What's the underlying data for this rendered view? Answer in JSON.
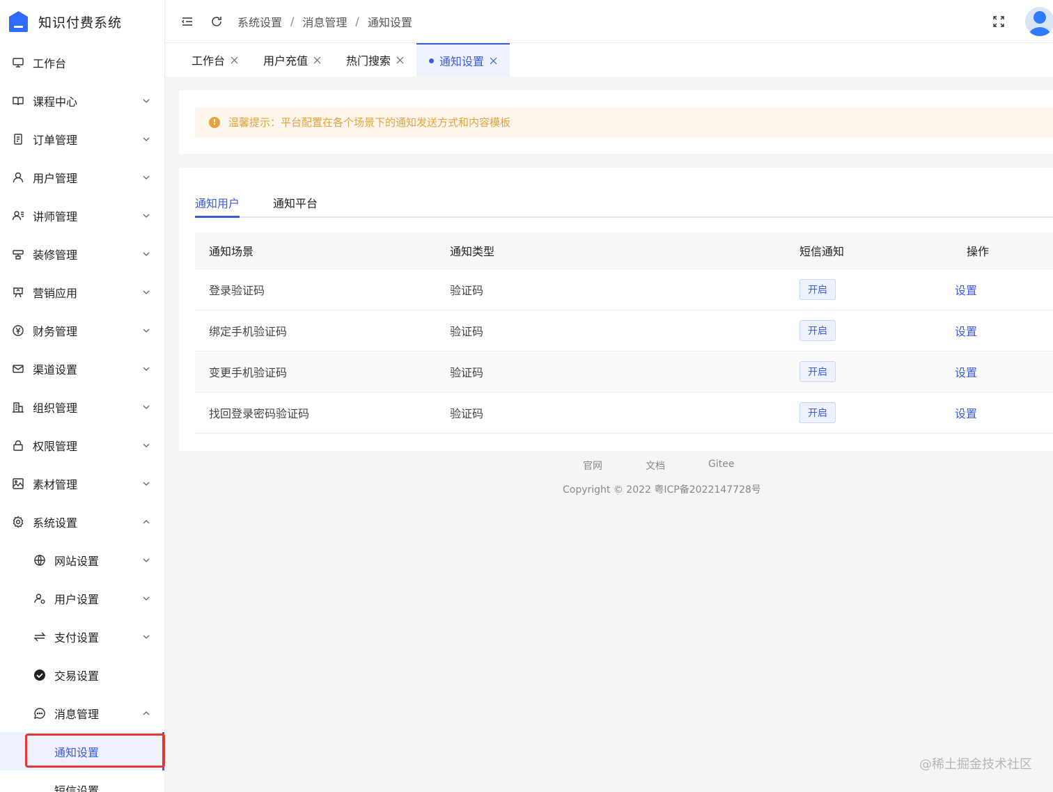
{
  "app": {
    "title": "知识付费系统"
  },
  "sidebar": {
    "items": [
      {
        "label": "工作台",
        "icon": "monitor-icon"
      },
      {
        "label": "课程中心",
        "icon": "book-icon"
      },
      {
        "label": "订单管理",
        "icon": "order-icon"
      },
      {
        "label": "用户管理",
        "icon": "user-icon"
      },
      {
        "label": "讲师管理",
        "icon": "teacher-icon"
      },
      {
        "label": "装修管理",
        "icon": "decoration-icon"
      },
      {
        "label": "营销应用",
        "icon": "marketing-icon"
      },
      {
        "label": "财务管理",
        "icon": "yuan-icon"
      },
      {
        "label": "渠道设置",
        "icon": "mail-icon"
      },
      {
        "label": "组织管理",
        "icon": "building-icon"
      },
      {
        "label": "权限管理",
        "icon": "lock-icon"
      },
      {
        "label": "素材管理",
        "icon": "image-icon"
      },
      {
        "label": "系统设置",
        "icon": "gear-icon"
      }
    ],
    "system_sub": [
      {
        "label": "网站设置",
        "icon": "globe-icon"
      },
      {
        "label": "用户设置",
        "icon": "user-settings-icon"
      },
      {
        "label": "支付设置",
        "icon": "swap-icon"
      },
      {
        "label": "交易设置",
        "icon": "check-circle-icon"
      },
      {
        "label": "消息管理",
        "icon": "chat-icon"
      }
    ],
    "message_sub": [
      {
        "label": "通知设置"
      },
      {
        "label": "短信设置"
      }
    ]
  },
  "header": {
    "breadcrumb": [
      "系统设置",
      "消息管理",
      "通知设置"
    ],
    "separator": "/"
  },
  "page_tabs": [
    {
      "label": "工作台"
    },
    {
      "label": "用户充值"
    },
    {
      "label": "热门搜索"
    },
    {
      "label": "通知设置"
    }
  ],
  "alert": {
    "text": "温馨提示：平台配置在各个场景下的通知发送方式和内容模板"
  },
  "sub_tabs": [
    {
      "label": "通知用户"
    },
    {
      "label": "通知平台"
    }
  ],
  "table": {
    "columns": [
      "通知场景",
      "通知类型",
      "短信通知",
      "操作"
    ],
    "rows": [
      {
        "scene": "登录验证码",
        "type": "验证码",
        "sms": "开启",
        "action": "设置"
      },
      {
        "scene": "绑定手机验证码",
        "type": "验证码",
        "sms": "开启",
        "action": "设置"
      },
      {
        "scene": "变更手机验证码",
        "type": "验证码",
        "sms": "开启",
        "action": "设置"
      },
      {
        "scene": "找回登录密码验证码",
        "type": "验证码",
        "sms": "开启",
        "action": "设置"
      }
    ]
  },
  "footer": {
    "links": [
      "官网",
      "文档",
      "Gitee"
    ],
    "copyright": "Copyright © 2022 粤ICP备2022147728号"
  },
  "watermark": "@稀土掘金技术社区",
  "colors": {
    "primary": "#3b5bdb",
    "warning": "#e6a23c",
    "highlight": "#e53935"
  }
}
